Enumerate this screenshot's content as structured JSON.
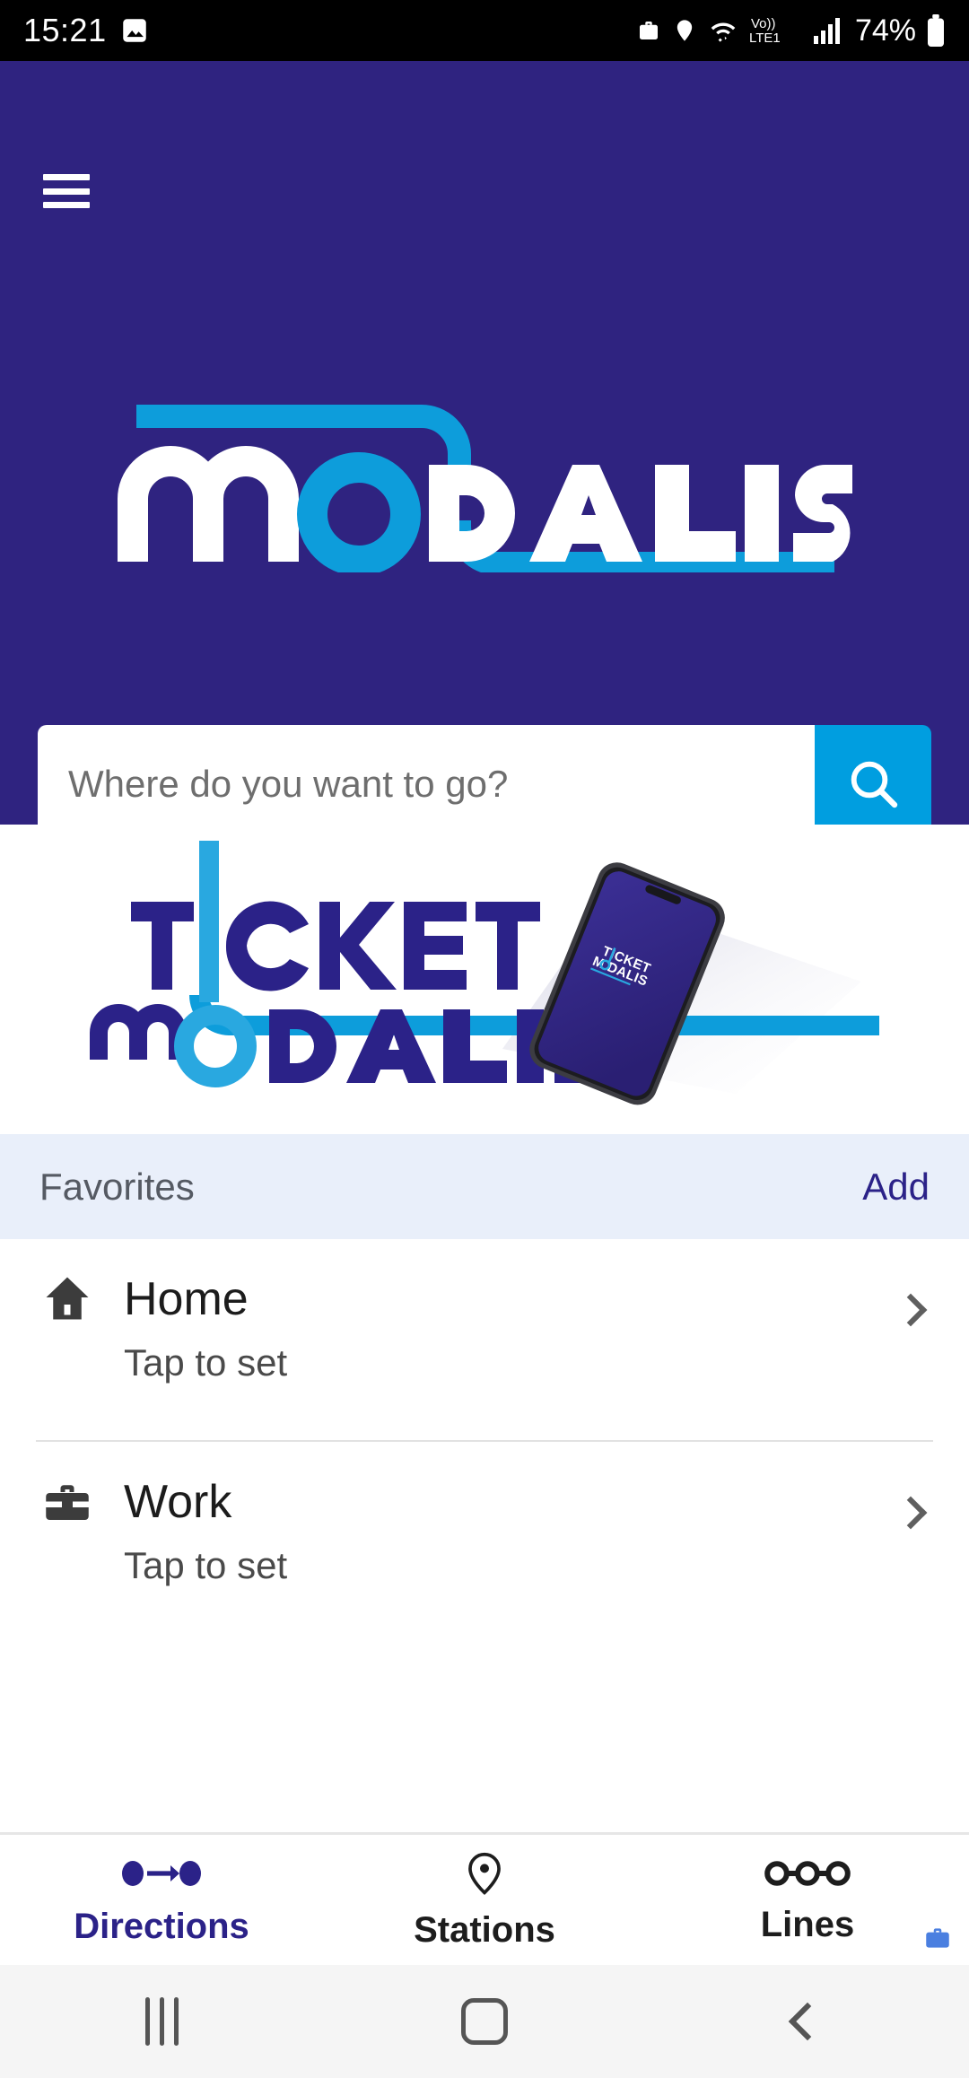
{
  "status_bar": {
    "time": "15:21",
    "battery_percent": "74%",
    "network_label": "VoLTE1",
    "volte_top": "Vo))",
    "icons": [
      "image-icon",
      "briefcase-icon",
      "location-pin-icon",
      "wifi-icon",
      "volte-icon",
      "signal-bars-icon",
      "battery-icon"
    ]
  },
  "header": {
    "menu_icon": "hamburger-menu-icon",
    "logo": {
      "text_primary": "m",
      "text_o": "O",
      "text_rest": "DALIS",
      "full_text": "mODALIS",
      "white": "#ffffff",
      "blue": "#0d9ddb"
    },
    "background_color": "#2f2380"
  },
  "search": {
    "placeholder": "Where do you want to go?",
    "value": "",
    "button_icon": "search-icon",
    "button_color": "#009ee0"
  },
  "promo": {
    "title_line1": "TICKET",
    "title_line2": "MODALIS",
    "phone_screen_line1": "TICKET",
    "phone_screen_line2": "MODALIS",
    "purple": "#2f2380",
    "blue": "#0d9ddb"
  },
  "favorites": {
    "section_title": "Favorites",
    "add_label": "Add",
    "items": [
      {
        "name": "Home",
        "subtitle": "Tap to set",
        "icon": "home-icon"
      },
      {
        "name": "Work",
        "subtitle": "Tap to set",
        "icon": "briefcase-icon"
      }
    ]
  },
  "tabs": [
    {
      "label": "Directions",
      "icon": "directions-icon",
      "active": true
    },
    {
      "label": "Stations",
      "icon": "location-pin-icon",
      "active": false
    },
    {
      "label": "Lines",
      "icon": "lines-icon",
      "active": false
    }
  ],
  "work_badge": {
    "icon": "work-briefcase-badge-icon",
    "color": "#4a7fe0"
  },
  "nav_bar": {
    "recents": "recents-icon",
    "home": "home-button-icon",
    "back": "back-icon"
  },
  "colors": {
    "brand_purple": "#2f2380",
    "brand_blue": "#0d9ddb",
    "accent_blue": "#009ee0",
    "fav_header_bg": "#e9effa"
  }
}
